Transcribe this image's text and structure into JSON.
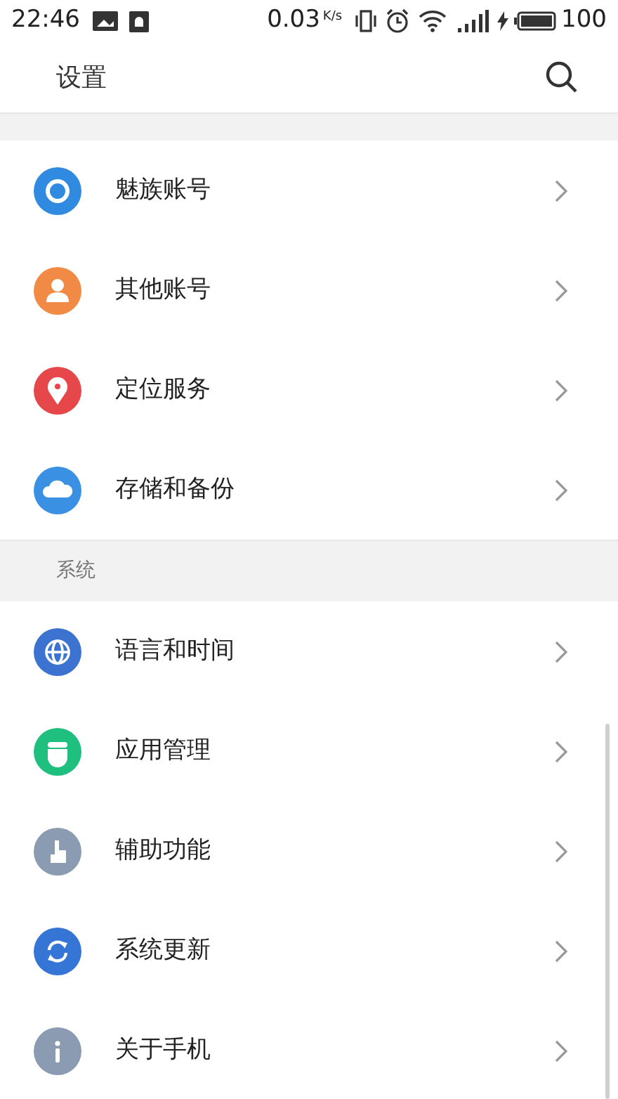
{
  "status_bar": {
    "time": "22:46",
    "speed": "0.03",
    "speed_unit": "K/s",
    "battery": "100"
  },
  "header": {
    "title": "设置"
  },
  "sections": [
    {
      "items": [
        {
          "label": "魅族账号",
          "kind": "ring",
          "color": "#2f8ae0"
        },
        {
          "label": "其他账号",
          "kind": "person",
          "color": "#f08a45"
        },
        {
          "label": "定位服务",
          "kind": "pin",
          "color": "#e5474b"
        },
        {
          "label": "存储和备份",
          "kind": "cloud",
          "color": "#3a91e4"
        }
      ]
    },
    {
      "title": "系统",
      "items": [
        {
          "label": "语言和时间",
          "kind": "globe",
          "color": "#3d73d0"
        },
        {
          "label": "应用管理",
          "kind": "android",
          "color": "#1fbf7f"
        },
        {
          "label": "辅助功能",
          "kind": "hand",
          "color": "#8a9bb2"
        },
        {
          "label": "系统更新",
          "kind": "refresh",
          "color": "#3475d6"
        },
        {
          "label": "关于手机",
          "kind": "info",
          "color": "#8a9bb2"
        }
      ]
    }
  ]
}
